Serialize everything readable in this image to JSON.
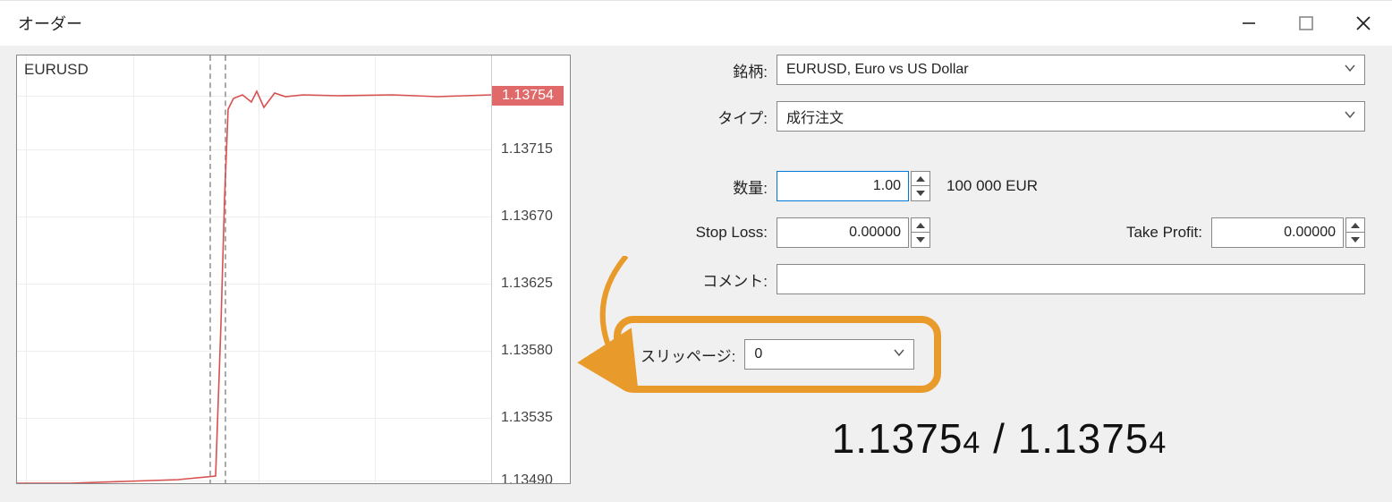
{
  "window": {
    "title": "オーダー"
  },
  "chart": {
    "symbol": "EURUSD",
    "price_tag": "1.13754",
    "y_ticks": [
      "1.13715",
      "1.13670",
      "1.13625",
      "1.13580",
      "1.13535",
      "1.13490"
    ]
  },
  "form": {
    "symbol_label": "銘柄:",
    "symbol_value": "EURUSD, Euro vs US Dollar",
    "type_label": "タイプ:",
    "type_value": "成行注文",
    "volume_label": "数量:",
    "volume_value": "1.00",
    "volume_suffix": "100 000 EUR",
    "sl_label": "Stop Loss:",
    "sl_value": "0.00000",
    "tp_label": "Take Profit:",
    "tp_value": "0.00000",
    "comment_label": "コメント:",
    "slippage_label": "スリッページ:",
    "slippage_value": "0"
  },
  "price_display": {
    "bid_main": "1.1375",
    "bid_sub": "4",
    "sep": " / ",
    "ask_main": "1.1375",
    "ask_sub": "4"
  },
  "chart_data": {
    "type": "line",
    "series_name": "EURUSD",
    "y_axis_ticks": [
      1.1349,
      1.13535,
      1.1358,
      1.13625,
      1.1367,
      1.13715
    ],
    "current_price": 1.13754,
    "note": "tick price chart; price rises sharply near mid then plateaus around 1.13754"
  }
}
